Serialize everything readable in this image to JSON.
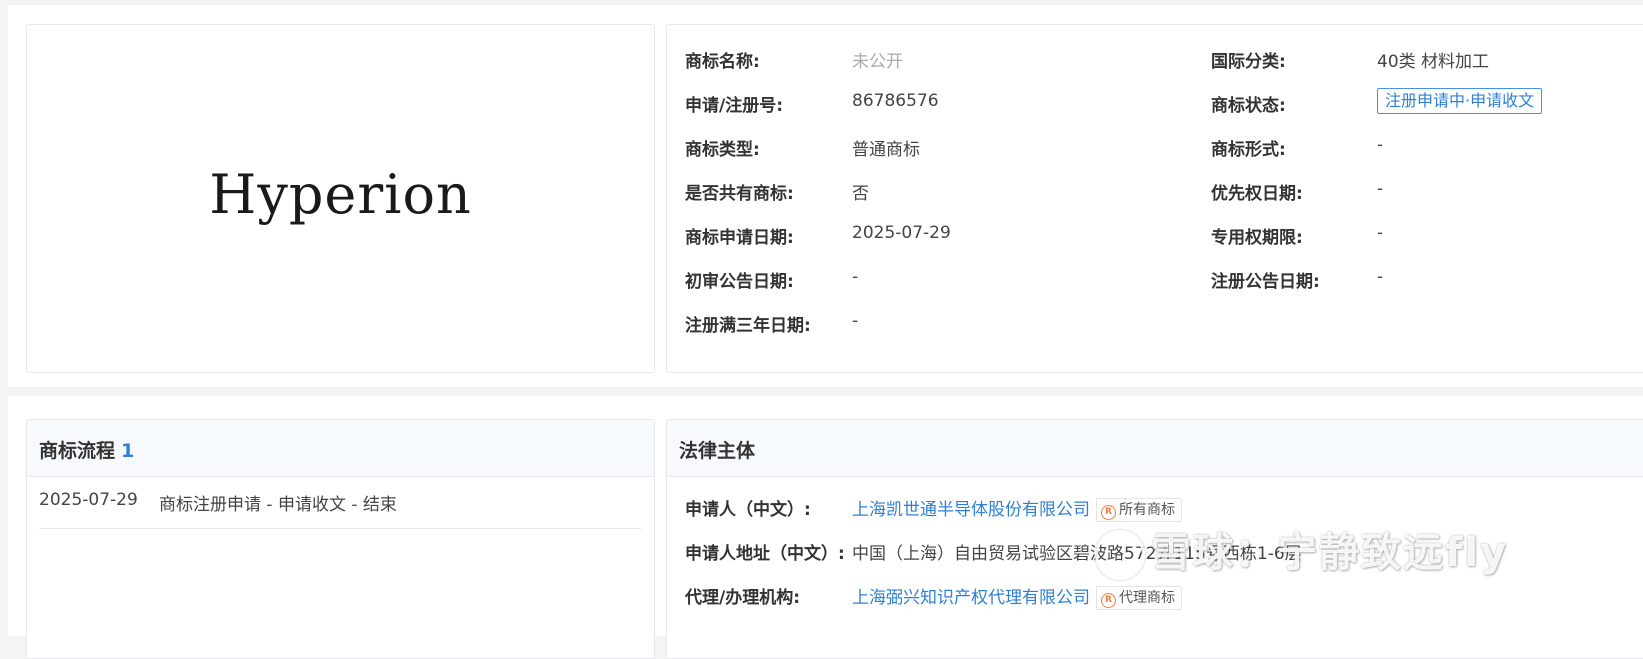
{
  "logo": {
    "text": "Hyperion"
  },
  "info_left": [
    {
      "label": "商标名称:",
      "value": "未公开"
    },
    {
      "label": "申请/注册号:",
      "value": "86786576"
    },
    {
      "label": "商标类型:",
      "value": "普通商标"
    },
    {
      "label": "是否共有商标:",
      "value": "否"
    },
    {
      "label": "商标申请日期:",
      "value": "2025-07-29"
    },
    {
      "label": "初审公告日期:",
      "value": "-"
    },
    {
      "label": "注册满三年日期:",
      "value": "-"
    }
  ],
  "info_right": [
    {
      "label": "国际分类:",
      "value": "40类 材料加工"
    },
    {
      "label": "商标状态:",
      "value": "注册申请中·申请收文"
    },
    {
      "label": "商标形式:",
      "value": "-"
    },
    {
      "label": "优先权日期:",
      "value": "-"
    },
    {
      "label": "专用权期限:",
      "value": "-"
    },
    {
      "label": "注册公告日期:",
      "value": "-"
    }
  ],
  "flow": {
    "title": "商标流程",
    "count": "1",
    "items": [
      {
        "date": "2025-07-29",
        "desc": "商标注册申请 - 申请收文 - 结束"
      }
    ]
  },
  "legal": {
    "title": "法律主体",
    "rows": [
      {
        "label": "申请人（中文）:",
        "value": "上海凯世通半导体股份有限公司",
        "badge": "所有商标"
      },
      {
        "label": "申请人地址（中文）:",
        "value": "中国（上海）自由贸易试验区碧波路572弄115号西栋1-6层"
      },
      {
        "label": "代理/办理机构:",
        "value": "上海弼兴知识产权代理有限公司",
        "badge": "代理商标"
      }
    ]
  },
  "watermark": {
    "text": "雪球：宁静致远fly"
  },
  "colors": {
    "accent": "#2f7fd6",
    "badge_icon": "#f07c3a"
  },
  "icons": {
    "badge": "registered-trademark-icon",
    "watermark": "snowball-logo-icon"
  }
}
